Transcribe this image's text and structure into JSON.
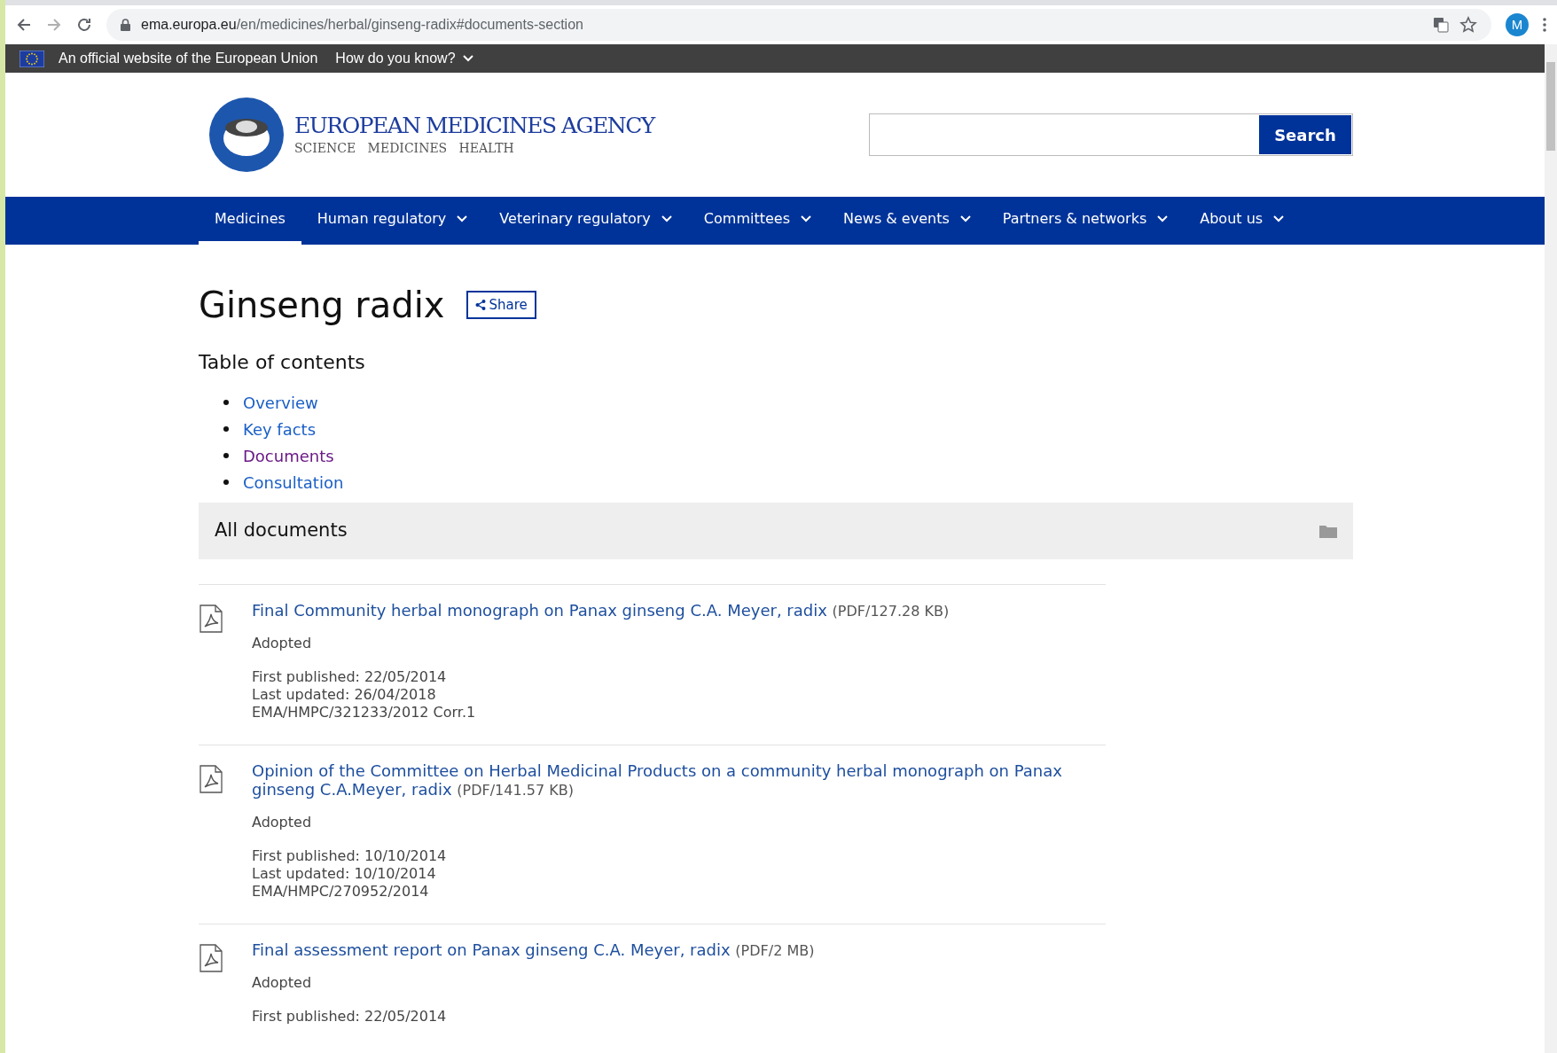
{
  "browser": {
    "url_host": "ema.europa.eu",
    "url_path": "/en/medicines/herbal/ginseng-radix#documents-section",
    "profile_initial": "M"
  },
  "eu_bar": {
    "text": "An official website of the European Union",
    "link": "How do you know?"
  },
  "header": {
    "logo_title": "EUROPEAN MEDICINES AGENCY",
    "logo_tagline": "SCIENCE   MEDICINES   HEALTH",
    "search_button": "Search"
  },
  "nav": [
    {
      "label": "Medicines",
      "selected": true,
      "dropdown": false
    },
    {
      "label": "Human regulatory",
      "selected": false,
      "dropdown": true
    },
    {
      "label": "Veterinary regulatory",
      "selected": false,
      "dropdown": true
    },
    {
      "label": "Committees",
      "selected": false,
      "dropdown": true
    },
    {
      "label": "News & events",
      "selected": false,
      "dropdown": true
    },
    {
      "label": "Partners & networks",
      "selected": false,
      "dropdown": true
    },
    {
      "label": "About us",
      "selected": false,
      "dropdown": true
    }
  ],
  "page": {
    "title": "Ginseng radix",
    "share": "Share",
    "toc_heading": "Table of contents",
    "toc": [
      {
        "label": "Overview",
        "visited": false
      },
      {
        "label": "Key facts",
        "visited": false
      },
      {
        "label": "Documents",
        "visited": true
      },
      {
        "label": "Consultation",
        "visited": false
      }
    ],
    "section_title": "All documents",
    "documents": [
      {
        "title": "Final Community herbal monograph on Panax ginseng C.A. Meyer, radix",
        "size": "(PDF/127.28 KB)",
        "status": "Adopted",
        "meta": [
          "First published: 22/05/2014",
          "Last updated: 26/04/2018",
          "EMA/HMPC/321233/2012 Corr.1"
        ]
      },
      {
        "title": "Opinion of the Committee on Herbal Medicinal Products on a community herbal monograph on Panax ginseng C.A.Meyer, radix",
        "size": "(PDF/141.57 KB)",
        "status": "Adopted",
        "meta": [
          "First published: 10/10/2014",
          "Last updated: 10/10/2014",
          "EMA/HMPC/270952/2014"
        ]
      },
      {
        "title": "Final assessment report on Panax ginseng C.A. Meyer, radix",
        "size": "(PDF/2 MB)",
        "status": "Adopted",
        "meta": [
          "First published: 22/05/2014"
        ]
      }
    ]
  }
}
